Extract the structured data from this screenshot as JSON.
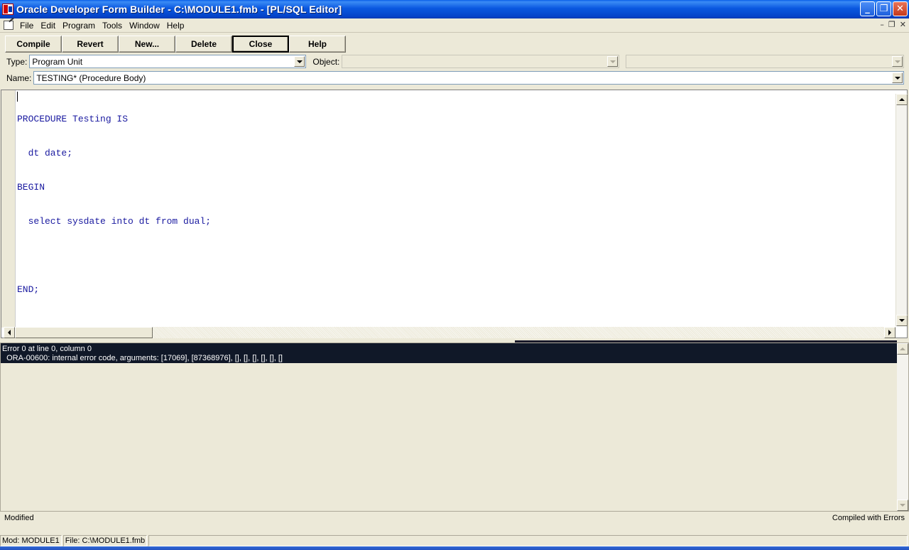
{
  "window": {
    "title": "Oracle Developer Form Builder - C:\\MODULE1.fmb - [PL/SQL Editor]",
    "minimize": "_",
    "maximize": "❐",
    "close": "✕"
  },
  "menu": {
    "items": [
      {
        "label": "File"
      },
      {
        "label": "Edit"
      },
      {
        "label": "Program"
      },
      {
        "label": "Tools"
      },
      {
        "label": "Window"
      },
      {
        "label": "Help"
      }
    ],
    "mdi_min": "–",
    "mdi_restore": "❐",
    "mdi_close": "✕"
  },
  "toolbar": {
    "compile": "Compile",
    "revert": "Revert",
    "new": "New...",
    "delete": "Delete",
    "close": "Close",
    "help": "Help"
  },
  "selectors": {
    "type_label": "Type:",
    "type_value": "Program Unit",
    "object_label": "Object:",
    "object_value": "",
    "object2_value": "",
    "name_label": "Name:",
    "name_value": "TESTING* (Procedure Body)"
  },
  "editor": {
    "lines": [
      "PROCEDURE Testing IS",
      "  dt date;",
      "BEGIN",
      "  select sysdate into dt from dual;",
      "",
      "END;"
    ],
    "code_color": "#1a1aa0"
  },
  "errors": {
    "line1": "Error 0 at line 0, column 0",
    "line2": "  ORA-00600: internal error code, arguments: [17069], [87368976], [], [], [], [], [], []"
  },
  "status": {
    "left": "Modified",
    "right": "Compiled with Errors"
  },
  "statusbar": {
    "mod": "Mod: MODULE1",
    "file": "File: C:\\MODULE1.fmb",
    "extra": ""
  }
}
